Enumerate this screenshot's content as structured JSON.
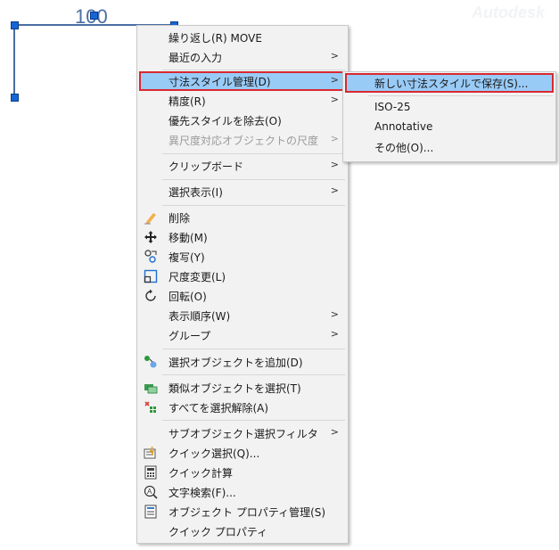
{
  "canvas": {
    "dimension_text": "100",
    "watermark": "Autodesk"
  },
  "context_menu": {
    "items": [
      {
        "label": "繰り返し(R) MOVE"
      },
      {
        "label": "最近の入力",
        "submenu": true
      },
      {
        "label": "寸法スタイル管理(D)",
        "submenu": true,
        "highlighted": true
      },
      {
        "label": "精度(R)",
        "submenu": true
      },
      {
        "label": "優先スタイルを除去(O)"
      },
      {
        "label": "異尺度対応オブジェクトの尺度",
        "submenu": true,
        "disabled": true
      },
      {
        "label": "クリップボード",
        "submenu": true
      },
      {
        "label": "選択表示(I)",
        "submenu": true
      },
      {
        "label": "削除",
        "icon": "eraser-icon"
      },
      {
        "label": "移動(M)",
        "icon": "move-icon"
      },
      {
        "label": "複写(Y)",
        "icon": "copy-icon"
      },
      {
        "label": "尺度変更(L)",
        "icon": "scale-icon"
      },
      {
        "label": "回転(O)",
        "icon": "rotate-icon"
      },
      {
        "label": "表示順序(W)",
        "submenu": true
      },
      {
        "label": "グループ",
        "submenu": true
      },
      {
        "label": "選択オブジェクトを追加(D)",
        "icon": "add-selected-icon"
      },
      {
        "label": "類似オブジェクトを選択(T)",
        "icon": "select-similar-icon"
      },
      {
        "label": "すべてを選択解除(A)",
        "icon": "deselect-all-icon"
      },
      {
        "label": "サブオブジェクト選択フィルタ",
        "submenu": true
      },
      {
        "label": "クイック選択(Q)...",
        "icon": "quick-select-icon"
      },
      {
        "label": "クイック計算",
        "icon": "calculator-icon"
      },
      {
        "label": "文字検索(F)...",
        "icon": "find-text-icon"
      },
      {
        "label": "オブジェクト プロパティ管理(S)",
        "icon": "properties-icon"
      },
      {
        "label": "クイック プロパティ"
      }
    ],
    "submenu_arrow": ">"
  },
  "submenu": {
    "items": [
      {
        "label": "新しい寸法スタイルで保存(S)...",
        "highlighted": true
      },
      {
        "label": "ISO-25"
      },
      {
        "label": "Annotative"
      },
      {
        "label": "その他(O)..."
      }
    ]
  },
  "colors": {
    "highlight": "#99cbf7",
    "highlight_border": "#d8292f",
    "grip": "#1565d8",
    "dimension": "#4a6ea5"
  }
}
